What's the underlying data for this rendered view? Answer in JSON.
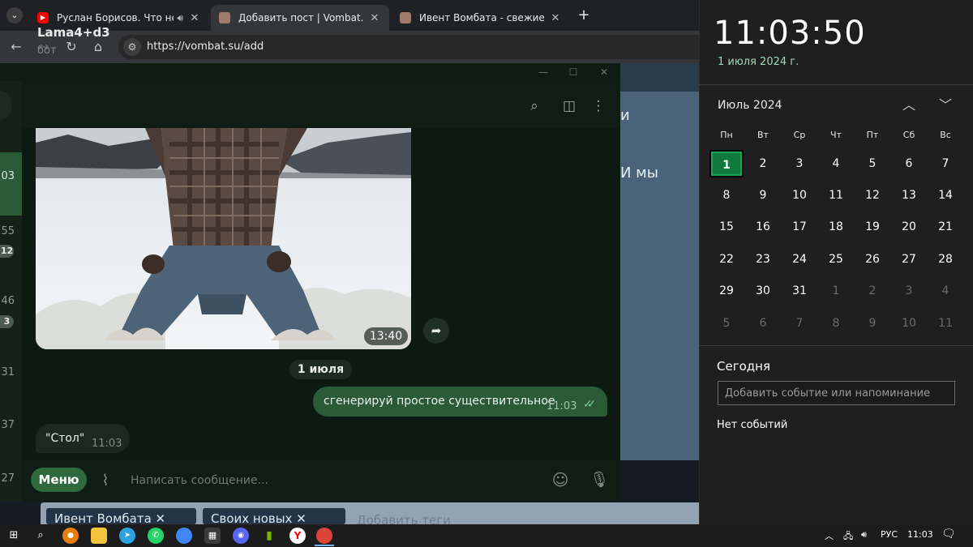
{
  "browser": {
    "tabs": [
      {
        "title": "Руслан Борисов. Что не так с...",
        "favicon_color": "#ff0000",
        "has_audio": true
      },
      {
        "title": "Добавить пост | Vombat.su",
        "favicon_color": "#a07a6a",
        "active": true
      },
      {
        "title": "Ивент Вомбата - свежие пост...",
        "favicon_color": "#a07a6a"
      }
    ],
    "url": "https://vombat.su/add"
  },
  "webpage": {
    "card_text_1": "и",
    "card_text_2": "И мы",
    "tags": [
      "Ивент Вомбата",
      "Своих новых"
    ],
    "tag_placeholder": "Добавить теги"
  },
  "telegram": {
    "chat_name": "Lama4+d3",
    "chat_status": "бот",
    "left_list": [
      {
        "time": "03"
      },
      {
        "time": "55",
        "badge": "12"
      },
      {
        "time": "46",
        "badge": "3"
      },
      {
        "time": "31"
      },
      {
        "time": "37"
      },
      {
        "time": "27"
      }
    ],
    "photo_time": "13:40",
    "date_chip": "1 июля",
    "messages": [
      {
        "dir": "out",
        "text": "сгенерируй простое существительное",
        "time": "11:03",
        "read": true
      },
      {
        "dir": "in",
        "text": "\"Стол\"",
        "time": "11:03"
      }
    ],
    "menu_label": "Меню",
    "input_placeholder": "Написать сообщение..."
  },
  "calendar": {
    "time": "11:03:50",
    "date_long": "1 июля 2024 г.",
    "month_label": "Июль 2024",
    "weekdays": [
      "Пн",
      "Вт",
      "Ср",
      "Чт",
      "Пт",
      "Сб",
      "Вс"
    ],
    "weeks": [
      [
        "1",
        "2",
        "3",
        "4",
        "5",
        "6",
        "7"
      ],
      [
        "8",
        "9",
        "10",
        "11",
        "12",
        "13",
        "14"
      ],
      [
        "15",
        "16",
        "17",
        "18",
        "19",
        "20",
        "21"
      ],
      [
        "22",
        "23",
        "24",
        "25",
        "26",
        "27",
        "28"
      ],
      [
        "29",
        "30",
        "31",
        "1",
        "2",
        "3",
        "4"
      ],
      [
        "5",
        "6",
        "7",
        "8",
        "9",
        "10",
        "11"
      ]
    ],
    "today_label": "Сегодня",
    "event_placeholder": "Добавить событие или напоминание",
    "no_events": "Нет событий"
  },
  "taskbar": {
    "lang": "РУС",
    "clock": "11:03"
  },
  "colors": {
    "accent_green": "#0f7a3b",
    "telegram_bg": "#0d1a12",
    "out_bubble": "#2b5a36"
  }
}
